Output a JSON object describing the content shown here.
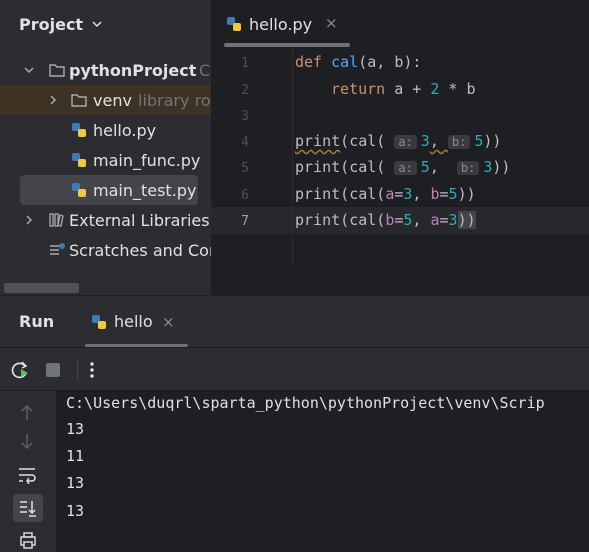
{
  "project_panel": {
    "title": "Project",
    "tree": {
      "root": {
        "name": "pythonProject",
        "path_hint": "C"
      },
      "venv": {
        "name": "venv",
        "hint": "library roo"
      },
      "files": [
        "hello.py",
        "main_func.py",
        "main_test.py"
      ],
      "external": "External Libraries",
      "scratches": "Scratches and Con"
    }
  },
  "editor": {
    "tab": {
      "label": "hello.py",
      "close": "×"
    },
    "lines": [
      {
        "n": "1",
        "text": "def cal(a, b):"
      },
      {
        "n": "2",
        "text": "return a + 2 * b"
      },
      {
        "n": "3",
        "text": ""
      },
      {
        "n": "4",
        "text": "print(cal( a: 3,  b: 5))"
      },
      {
        "n": "5",
        "text": "print(cal( a: 5,  b: 3))"
      },
      {
        "n": "6",
        "text": "print(cal(a=3, b=5))"
      },
      {
        "n": "7",
        "text": "print(cal(b=5, a=3))"
      }
    ],
    "tokens": {
      "def": "def",
      "cal": "cal",
      "sig": "(a, b):",
      "ret": "return",
      "ret_a": " a + ",
      "two": "2",
      "ret_b": " * b",
      "print": "print",
      "open": "(",
      "close2": "))",
      "comma": ", ",
      "hint_a": "a:",
      "hint_b": "b:",
      "v3": "3",
      "v5": "5",
      "p_a": "a",
      "p_b": "b",
      "eq": "="
    }
  },
  "run_panel": {
    "title": "Run",
    "tab": {
      "label": "hello",
      "close": "×"
    },
    "console": [
      "C:\\Users\\duqrl\\sparta_python\\pythonProject\\venv\\Scrip",
      "13",
      "11",
      "13",
      "13"
    ]
  },
  "colors": {
    "keyword": "#cf8e6d",
    "function": "#56a8f5",
    "number": "#2aacb8",
    "param": "#c77dbb",
    "rerun_green": "#5fb865"
  }
}
